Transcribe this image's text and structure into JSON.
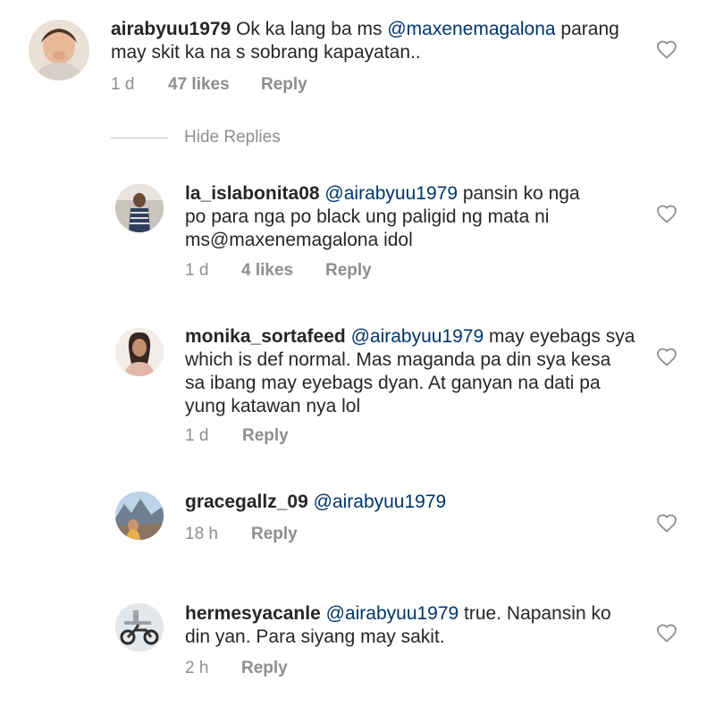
{
  "comments": [
    {
      "username": "airabyuu1979",
      "text_before": " Ok ka lang ba ms ",
      "mention": "@maxenemagalona",
      "text_after": "  parang",
      "line2": "may skit ka na s sobrang kapayatan..",
      "time": "1 d",
      "likes": "47 likes",
      "reply": "Reply"
    }
  ],
  "hide_replies": "Hide Replies",
  "replies": [
    {
      "username": "la_islabonita08",
      "mention": "@airabyuu1979",
      "text_line1": " pansin ko nga",
      "line2": "po para nga po black ung paligid ng mata ni",
      "line3": "ms@maxenemagalona idol",
      "time": "1 d",
      "likes": "4 likes",
      "reply": "Reply"
    },
    {
      "username": "monika_sortafeed",
      "mention": "@airabyuu1979",
      "text_line1": " may eyebags sya",
      "line2": "which is def normal. Mas maganda pa din sya kesa",
      "line3": "sa ibang may eyebags dyan. At ganyan na dati pa",
      "line4": "yung katawan nya lol",
      "time": "1 d",
      "reply": "Reply"
    },
    {
      "username": "gracegallz_09",
      "mention": "@airabyuu1979",
      "time": "18 h",
      "reply": "Reply"
    },
    {
      "username": "hermesyacanle",
      "mention": "@airabyuu1979",
      "text_line1": " true. Napansin ko",
      "line2": "din yan. Para siyang may sakit.",
      "time": "2 h",
      "reply": "Reply"
    }
  ],
  "colors": {
    "text": "#262626",
    "meta": "#8e8e8e",
    "mention": "#003569",
    "heart_outline": "#8e8e8e"
  },
  "icons": [
    "heart-icon",
    "avatar"
  ]
}
